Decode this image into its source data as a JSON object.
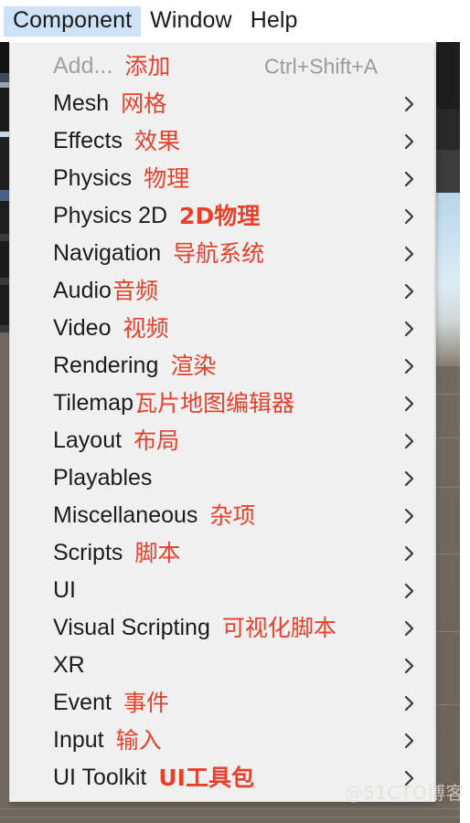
{
  "menubar": {
    "items": [
      {
        "label": "Component",
        "active": true
      },
      {
        "label": "Window",
        "active": false
      },
      {
        "label": "Help",
        "active": false
      }
    ]
  },
  "dropdown": {
    "items": [
      {
        "en": "Add...",
        "cn": "添加",
        "accel": "Ctrl+Shift+A",
        "submenu": false,
        "disabled": true,
        "cn_bold": false
      },
      {
        "en": "Mesh",
        "cn": "网格",
        "accel": "",
        "submenu": true,
        "disabled": false,
        "cn_bold": false
      },
      {
        "en": "Effects",
        "cn": "效果",
        "accel": "",
        "submenu": true,
        "disabled": false,
        "cn_bold": false
      },
      {
        "en": "Physics",
        "cn": "物理",
        "accel": "",
        "submenu": true,
        "disabled": false,
        "cn_bold": false
      },
      {
        "en": "Physics 2D",
        "cn": "2D物理",
        "accel": "",
        "submenu": true,
        "disabled": false,
        "cn_bold": true
      },
      {
        "en": "Navigation",
        "cn": "导航系统",
        "accel": "",
        "submenu": true,
        "disabled": false,
        "cn_bold": false
      },
      {
        "en": "Audio",
        "cn": "音频",
        "accel": "",
        "submenu": true,
        "disabled": false,
        "cn_bold": false
      },
      {
        "en": "Video",
        "cn": "视频",
        "accel": "",
        "submenu": true,
        "disabled": false,
        "cn_bold": false
      },
      {
        "en": "Rendering",
        "cn": "渲染",
        "accel": "",
        "submenu": true,
        "disabled": false,
        "cn_bold": false
      },
      {
        "en": "Tilemap",
        "cn": "瓦片地图编辑器",
        "accel": "",
        "submenu": true,
        "disabled": false,
        "cn_bold": false
      },
      {
        "en": "Layout",
        "cn": "布局",
        "accel": "",
        "submenu": true,
        "disabled": false,
        "cn_bold": false
      },
      {
        "en": "Playables",
        "cn": "",
        "accel": "",
        "submenu": true,
        "disabled": false,
        "cn_bold": false
      },
      {
        "en": "Miscellaneous",
        "cn": "杂项",
        "accel": "",
        "submenu": true,
        "disabled": false,
        "cn_bold": false
      },
      {
        "en": "Scripts",
        "cn": "脚本",
        "accel": "",
        "submenu": true,
        "disabled": false,
        "cn_bold": false
      },
      {
        "en": "UI",
        "cn": "",
        "accel": "",
        "submenu": true,
        "disabled": false,
        "cn_bold": false
      },
      {
        "en": "Visual Scripting",
        "cn": "可视化脚本",
        "accel": "",
        "submenu": true,
        "disabled": false,
        "cn_bold": false
      },
      {
        "en": "XR",
        "cn": "",
        "accel": "",
        "submenu": true,
        "disabled": false,
        "cn_bold": false
      },
      {
        "en": "Event",
        "cn": "事件",
        "accel": "",
        "submenu": true,
        "disabled": false,
        "cn_bold": false
      },
      {
        "en": "Input",
        "cn": "输入",
        "accel": "",
        "submenu": true,
        "disabled": false,
        "cn_bold": false
      },
      {
        "en": "UI Toolkit",
        "cn": "UI工具包",
        "accel": "",
        "submenu": true,
        "disabled": false,
        "cn_bold": true
      }
    ]
  },
  "watermark": {
    "text": "@51CTO博客"
  },
  "colors": {
    "menu_background": "#f0f0f0",
    "menubar_background": "#ffffff",
    "active_highlight": "#cde2f7",
    "annotation_red": "#e8402a",
    "label_text": "#1c1c1c",
    "disabled_text": "#a0a0a0",
    "accel_text": "#9a9a9a"
  }
}
